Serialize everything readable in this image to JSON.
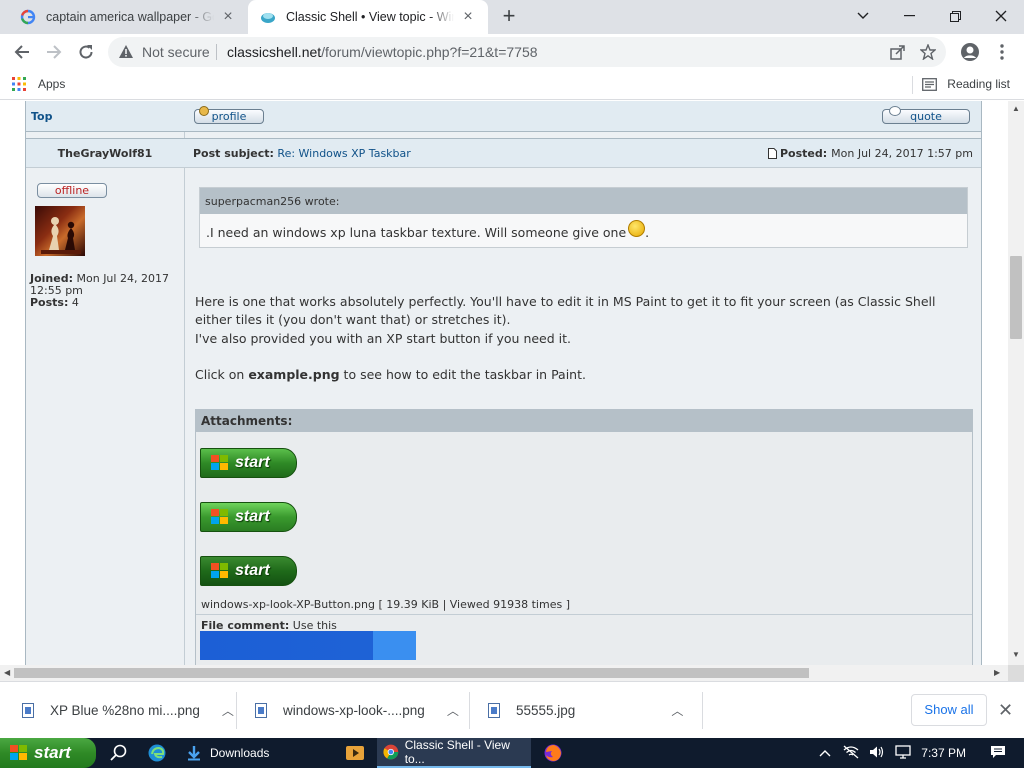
{
  "browser": {
    "tabs": [
      {
        "title": "captain america wallpaper - Google Search",
        "active": false
      },
      {
        "title": "Classic Shell • View topic - Windows XP Taskbar",
        "active": true
      }
    ],
    "omnibox": {
      "security_label": "Not secure",
      "url_host": "classicshell.net",
      "url_path": "/forum/viewtopic.php?f=21&t=7758"
    },
    "bookmarks": {
      "apps_label": "Apps",
      "reading_list_label": "Reading list"
    }
  },
  "forum": {
    "top_link": "Top",
    "profile_label": "profile",
    "quote_label": "quote",
    "author": "TheGrayWolf81",
    "status": "offline",
    "joined_label": "Joined:",
    "joined_value": "Mon Jul 24, 2017 12:55 pm",
    "posts_label": "Posts:",
    "posts_value": "4",
    "subject_label": "Post subject:",
    "subject_value": "Re: Windows XP Taskbar",
    "posted_label": "Posted:",
    "posted_value": "Mon Jul 24, 2017 1:57 pm",
    "quote_author": "superpacman256 wrote:",
    "quote_text": ".I need an windows xp luna taskbar texture. Will someone give one",
    "quote_end": ".",
    "paragraph1": "Here is one that works absolutely perfectly. You'll have to edit it in MS Paint to get it to fit your screen (as Classic Shell either tiles it (you don't want that) or stretches it).",
    "paragraph2": "I've also provided you with an XP start button if you need it.",
    "paragraph3_pre": "Click on ",
    "paragraph3_link": "example.png",
    "paragraph3_post": " to see how to edit the taskbar in Paint.",
    "attachments_header": "Attachments:",
    "start_button_text": "start",
    "attachment_caption": "windows-xp-look-XP-Button.png [ 19.39 KiB | Viewed 91938 times ]",
    "file_comment_label": "File comment:",
    "file_comment_value": "Use this"
  },
  "downloads": {
    "items": [
      {
        "name": "XP Blue %28no mi....png"
      },
      {
        "name": "windows-xp-look-....png"
      },
      {
        "name": "55555.jpg"
      }
    ],
    "show_all": "Show all"
  },
  "taskbar": {
    "start_label": "start",
    "downloads_label": "Downloads",
    "chrome_label": "Classic Shell - View to...",
    "clock": "7:37 PM"
  }
}
